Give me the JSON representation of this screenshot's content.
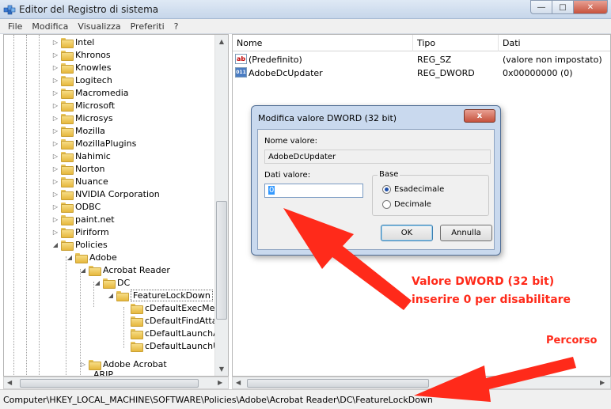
{
  "window": {
    "title": "Editor del Registro di sistema"
  },
  "menu": [
    "File",
    "Modifica",
    "Visualizza",
    "Preferiti",
    "?"
  ],
  "tree": {
    "top_items": [
      "Intel",
      "Khronos",
      "Knowles",
      "Logitech",
      "Macromedia",
      "Microsoft",
      "Microsys",
      "Mozilla",
      "MozillaPlugins",
      "Nahimic",
      "Norton",
      "Nuance",
      "NVIDIA Corporation",
      "ODBC",
      "paint.net",
      "Piriform"
    ],
    "policies": "Policies",
    "adobe": "Adobe",
    "acrobat_reader": "Acrobat Reader",
    "dc": "DC",
    "feature_lock_down": "FeatureLockDown",
    "children": [
      "cDefaultExecMenu",
      "cDefaultFindAttacl",
      "cDefaultLaunchAtt",
      "cDefaultLaunchUR"
    ],
    "adobe_acrobat": "Adobe Acrobat",
    "partial": "ARIP"
  },
  "list": {
    "columns": [
      "Nome",
      "Tipo",
      "Dati"
    ],
    "rows": [
      {
        "icon": "string-value-icon",
        "glyph": "ab",
        "name": "(Predefinito)",
        "type": "REG_SZ",
        "data": "(valore non impostato)"
      },
      {
        "icon": "dword-value-icon",
        "glyph": "011",
        "name": "AdobeDcUpdater",
        "type": "REG_DWORD",
        "data": "0x00000000 (0)"
      }
    ]
  },
  "dialog": {
    "title": "Modifica valore DWORD (32 bit)",
    "close_glyph": "x",
    "name_label": "Nome valore:",
    "name_value": "AdobeDcUpdater",
    "data_label": "Dati valore:",
    "data_value": "0",
    "base_label": "Base",
    "hex_label": "Esadecimale",
    "dec_label": "Decimale",
    "ok_label": "OK",
    "cancel_label": "Annulla"
  },
  "status": {
    "path": "Computer\\HKEY_LOCAL_MACHINE\\SOFTWARE\\Policies\\Adobe\\Acrobat Reader\\DC\\FeatureLockDown"
  },
  "annotations": {
    "dword_line1": "Valore DWORD (32 bit)",
    "dword_line2": "inserire 0 per disabilitare",
    "path_label": "Percorso",
    "color": "#ff2a1a"
  }
}
